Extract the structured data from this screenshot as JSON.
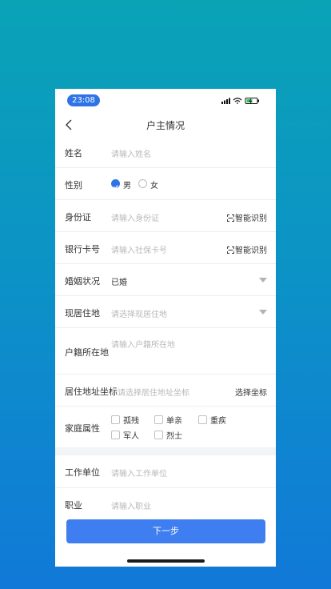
{
  "status_bar": {
    "time": "23:08"
  },
  "nav": {
    "title": "户主情况"
  },
  "form": {
    "name": {
      "label": "姓名",
      "placeholder": "请输入姓名"
    },
    "gender": {
      "label": "性别",
      "options": [
        "男",
        "女"
      ],
      "selected": "男"
    },
    "id_card": {
      "label": "身份证",
      "placeholder": "请输入身份证",
      "action": "智能识别"
    },
    "bank_card": {
      "label": "银行卡号",
      "placeholder": "请输入社保卡号",
      "action": "智能识别"
    },
    "marital": {
      "label": "婚姻状况",
      "value": "已婚"
    },
    "residence": {
      "label": "现居住地",
      "placeholder": "请选择现居住地"
    },
    "household_reg": {
      "label": "户籍所在地",
      "placeholder": "请输入户籍所在地"
    },
    "coords": {
      "label": "居住地址坐标",
      "placeholder": "请选择居住地址坐标",
      "action": "选择坐标"
    },
    "family_attr": {
      "label": "家庭属性",
      "options": [
        "孤残",
        "单亲",
        "重疾",
        "军人",
        "烈士"
      ]
    },
    "work_unit": {
      "label": "工作单位",
      "placeholder": "请输入工作单位"
    },
    "occupation": {
      "label": "职业",
      "placeholder": "请输入职业"
    }
  },
  "next_button": {
    "label": "下一步"
  },
  "colors": {
    "accent": "#2f74e6",
    "button": "#3e7ef0"
  }
}
